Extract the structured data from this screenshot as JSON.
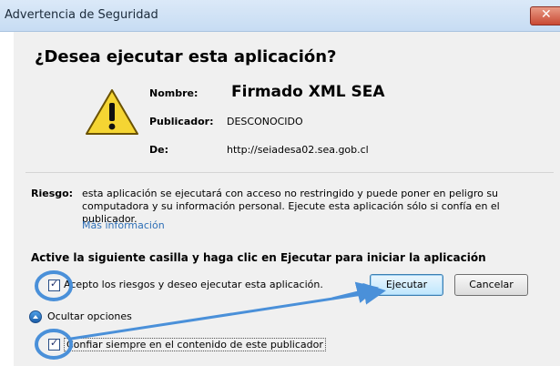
{
  "window": {
    "title": "Advertencia de Seguridad",
    "close_icon": "x-icon"
  },
  "dialog": {
    "heading": "¿Desea ejecutar esta aplicación?",
    "icon": "warning-icon",
    "name_label": "Nombre:",
    "name_value": "Firmado XML SEA",
    "publisher_label": "Publicador:",
    "publisher_value": "DESCONOCIDO",
    "from_label": "De:",
    "from_value": "http://seiadesa02.sea.gob.cl",
    "risk_label": "Riesgo:",
    "risk_line1": "esta aplicación se ejecutará con acceso no restringido y puede poner en peligro su",
    "risk_line2": "computadora y su información personal. Ejecute esta aplicación sólo si confía en el publicador.",
    "more_info": "Más información",
    "activate_heading": "Active la siguiente casilla y haga clic en Ejecutar para iniciar la aplicación",
    "accept_checkbox": {
      "label": "Acepto los riesgos y deseo ejecutar esta aplicación.",
      "checked": true
    },
    "run_button": "Ejecutar",
    "cancel_button": "Cancelar",
    "hide_options": "Ocultar opciones",
    "trust_checkbox": {
      "label": "Confiar siempre en el contenido de este publicador",
      "checked": true
    }
  },
  "colors": {
    "link": "#2e6fb6",
    "annotation": "#4a90d9"
  }
}
